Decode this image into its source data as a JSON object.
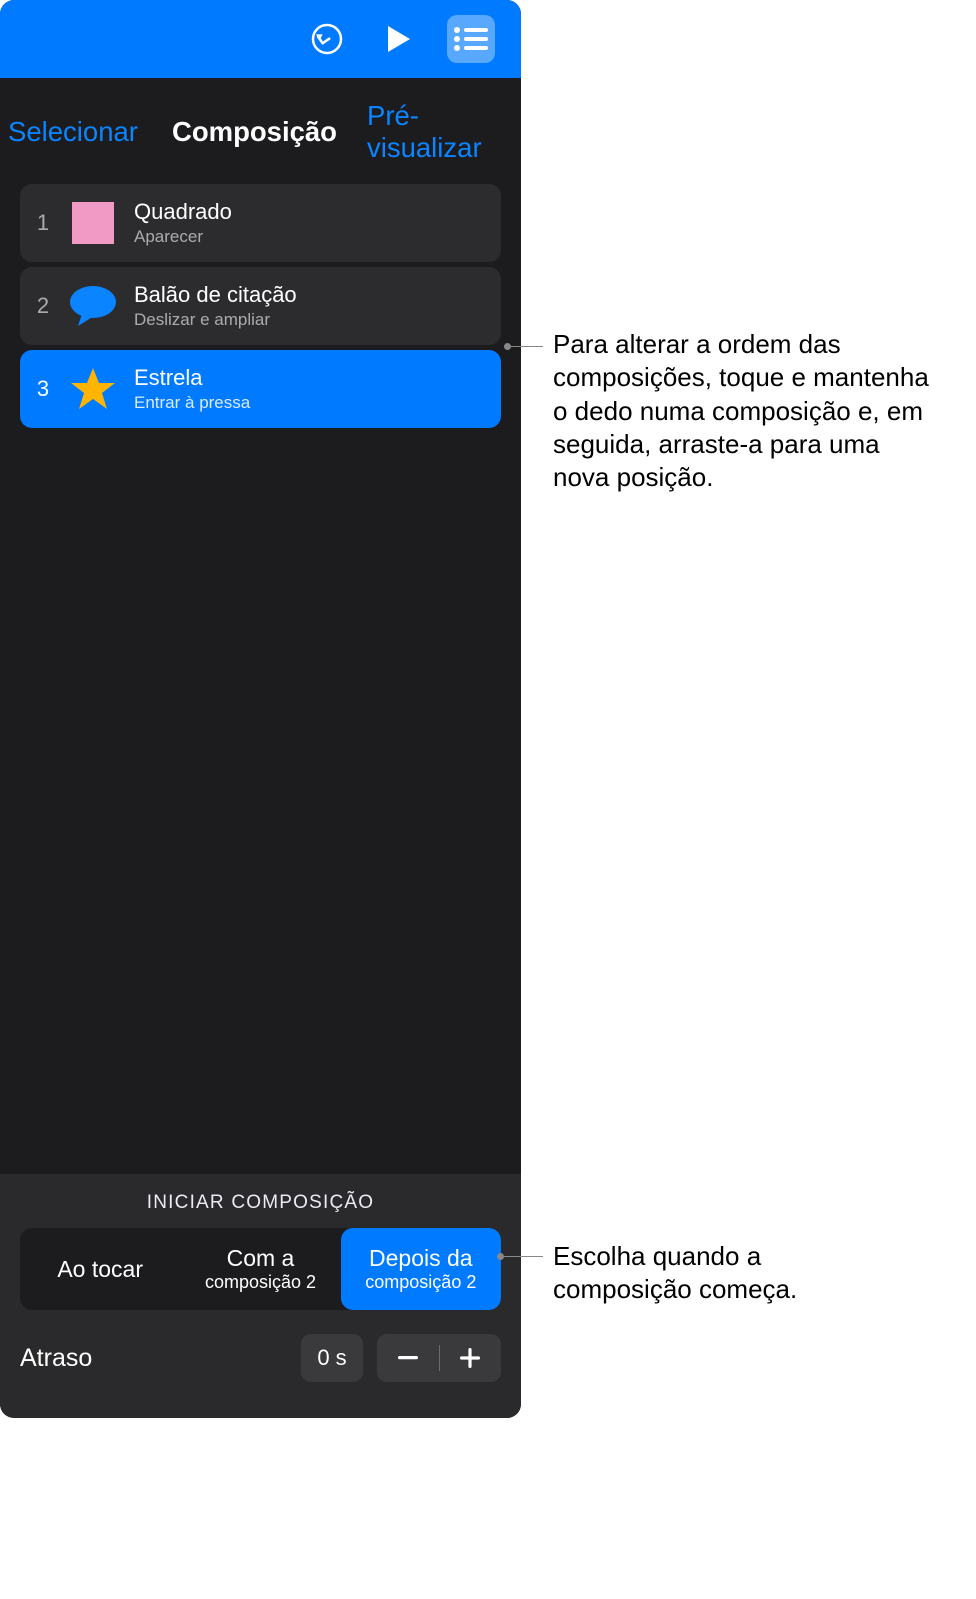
{
  "tabs": {
    "select": "Selecionar",
    "compose": "Composição",
    "preview": "Pré-visualizar"
  },
  "rows": [
    {
      "num": "1",
      "title": "Quadrado",
      "sub": "Aparecer"
    },
    {
      "num": "2",
      "title": "Balão de citação",
      "sub": "Deslizar e ampliar"
    },
    {
      "num": "3",
      "title": "Estrela",
      "sub": "Entrar à pressa"
    }
  ],
  "footer": {
    "title": "INICIAR COMPOSIÇÃO",
    "seg": [
      {
        "top": "Ao tocar",
        "bot": ""
      },
      {
        "top": "Com a",
        "bot": "composição 2"
      },
      {
        "top": "Depois da",
        "bot": "composição 2"
      }
    ],
    "delayLabel": "Atraso",
    "delayValue": "0 s"
  },
  "callouts": {
    "reorder": "Para alterar a ordem das composições, toque e mantenha o dedo numa composição e, em seguida, arraste-a para uma nova posição.",
    "start": "Escolha quando a composição começa."
  }
}
